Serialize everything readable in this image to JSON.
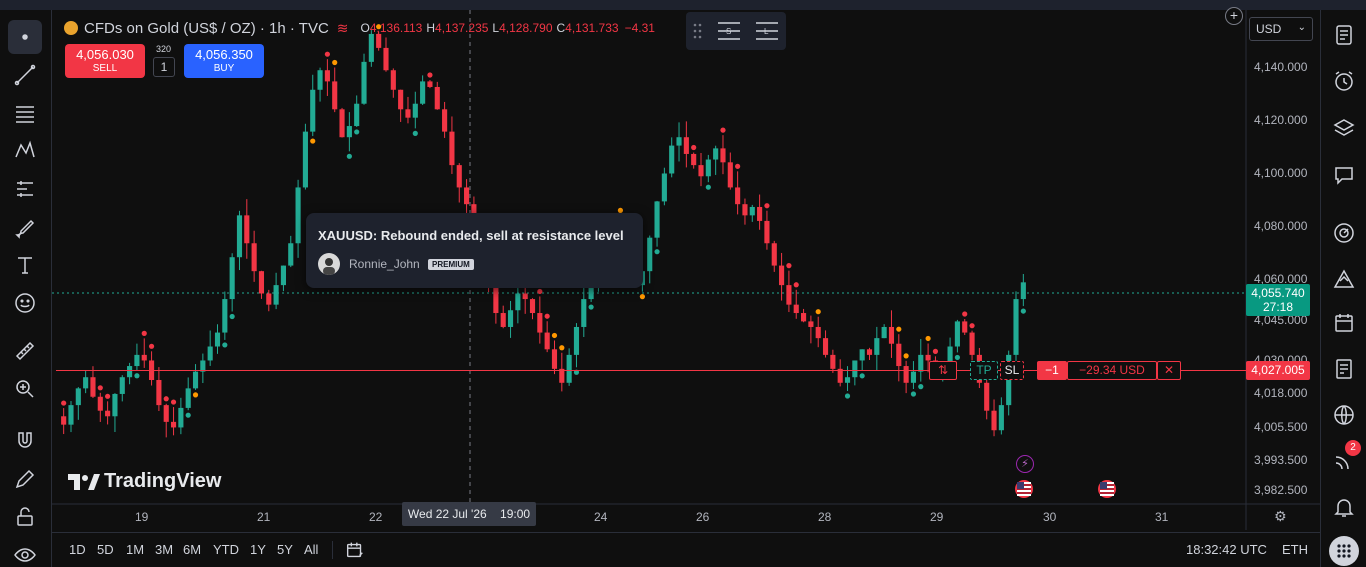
{
  "header": {
    "symbol_title": "CFDs on Gold (US$ / OZ) · 1h · TVC",
    "ohlc": [
      {
        "label": "O",
        "value": "4,136.113"
      },
      {
        "label": "H",
        "value": "4,137.235"
      },
      {
        "label": "L",
        "value": "4,128.790"
      },
      {
        "label": "C",
        "value": "4,131.733"
      },
      {
        "label": "",
        "value": "−4.31"
      }
    ]
  },
  "trade": {
    "sell_price": "4,056.030",
    "sell_label": "SELL",
    "spread": "320",
    "quantity": "1",
    "buy_price": "4,056.350",
    "buy_label": "BUY"
  },
  "currency_select": "USD",
  "idea_tooltip": {
    "title": "XAUUSD: Rebound ended, sell at resistance level",
    "author": "Ronnie_John",
    "badge": "PREMIUM"
  },
  "logo_text": "TradingView",
  "price_axis": {
    "labels": [
      "4,140.000",
      "4,120.000",
      "4,100.000",
      "4,080.000",
      "4,060.000",
      "4,045.000",
      "4,030.000",
      "4,018.000",
      "4,005.500",
      "3,993.500",
      "3,982.500"
    ],
    "current_price": "4,055.740",
    "countdown": "27:18",
    "position_price": "4,027.005"
  },
  "time_axis": {
    "labels": [
      "19",
      "21",
      "22",
      "24",
      "26",
      "28",
      "29",
      "30",
      "31"
    ],
    "crosshair_date": "Wed 22 Jul '26",
    "crosshair_time": "19:00"
  },
  "position": {
    "qty": "−1",
    "pnl": "−29.34 USD",
    "close": "✕",
    "tp": "TP",
    "sl": "SL",
    "reverse": "⇅"
  },
  "bottom": {
    "ranges": [
      "1D",
      "5D",
      "1M",
      "3M",
      "6M",
      "YTD",
      "1Y",
      "5Y",
      "All"
    ],
    "clock": "18:32:42 UTC",
    "session": "ETH"
  },
  "notifications_count": "2",
  "colors": {
    "up": "#22ab94",
    "down": "#f23645",
    "buy": "#2962ff",
    "background": "#0f0f0f"
  },
  "chart_data": {
    "type": "candlestick",
    "ylim": [
      3978,
      4150
    ],
    "seed": 7,
    "series": [
      {
        "name": "close",
        "values": [
          4005,
          4012,
          4018,
          4022,
          4015,
          4010,
          4008,
          4016,
          4022,
          4026,
          4030,
          4028,
          4021,
          4012,
          4006,
          4004,
          4011,
          4018,
          4024,
          4028,
          4033,
          4038,
          4050,
          4065,
          4080,
          4070,
          4060,
          4052,
          4048,
          4055,
          4062,
          4070,
          4090,
          4110,
          4125,
          4132,
          4128,
          4118,
          4108,
          4112,
          4120,
          4135,
          4145,
          4140,
          4132,
          4125,
          4118,
          4115,
          4120,
          4128,
          4126,
          4118,
          4110,
          4098,
          4090,
          4084,
          4078,
          4070,
          4058,
          4045,
          4040,
          4046,
          4052,
          4050,
          4045,
          4038,
          4032,
          4025,
          4020,
          4030,
          4040,
          4050,
          4058,
          4065,
          4072,
          4078,
          4070,
          4062,
          4055,
          4060,
          4072,
          4085,
          4095,
          4105,
          4108,
          4102,
          4098,
          4094,
          4100,
          4104,
          4099,
          4090,
          4084,
          4080,
          4083,
          4078,
          4070,
          4062,
          4055,
          4048,
          4045,
          4042,
          4040,
          4036,
          4030,
          4025,
          4020,
          4022,
          4028,
          4032,
          4030,
          4036,
          4040,
          4034,
          4026,
          4020,
          4024,
          4030,
          4028,
          4022,
          4026,
          4033,
          4042,
          4038,
          4030,
          4020,
          4010,
          4003,
          4012,
          4030,
          4050,
          4056
        ]
      }
    ]
  }
}
